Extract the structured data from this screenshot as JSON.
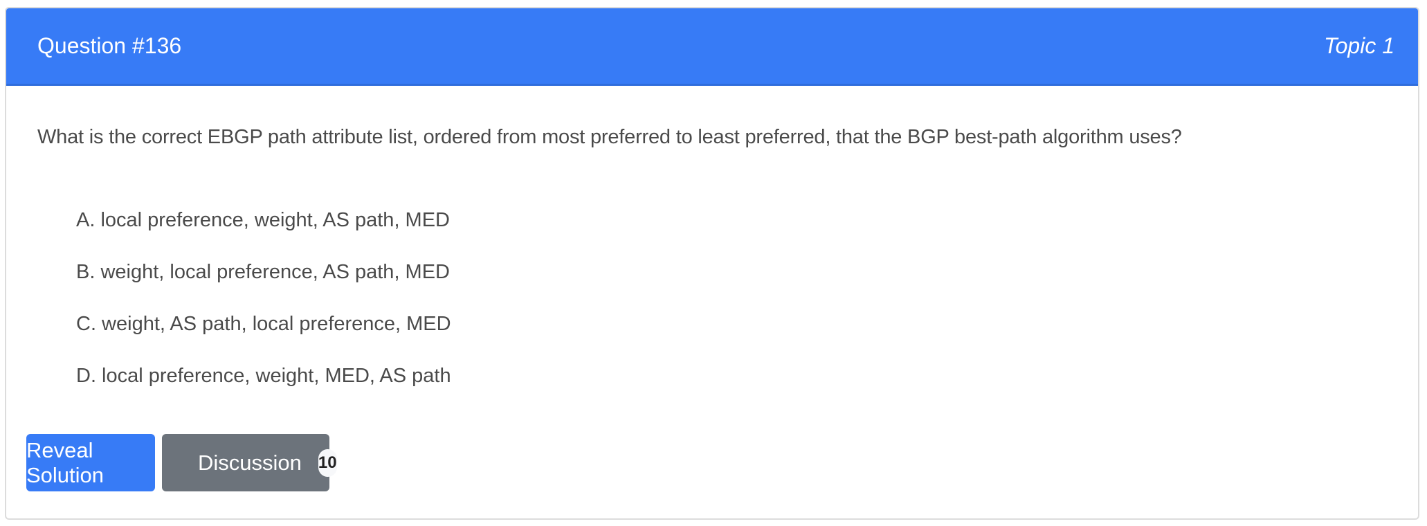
{
  "header": {
    "title": "Question #136",
    "topic": "Topic 1"
  },
  "question": "What is the correct EBGP path attribute list, ordered from most preferred to least preferred, that the BGP best-path algorithm uses?",
  "options": [
    "A. local preference, weight, AS path, MED",
    "B. weight, local preference, AS path, MED",
    "C. weight, AS path, local preference, MED",
    "D. local preference, weight, MED, AS path"
  ],
  "buttons": {
    "reveal": "Reveal Solution",
    "discussion": "Discussion",
    "discussion_count": "10"
  },
  "colors": {
    "primary": "#377bf6",
    "secondary": "#6c737b"
  }
}
